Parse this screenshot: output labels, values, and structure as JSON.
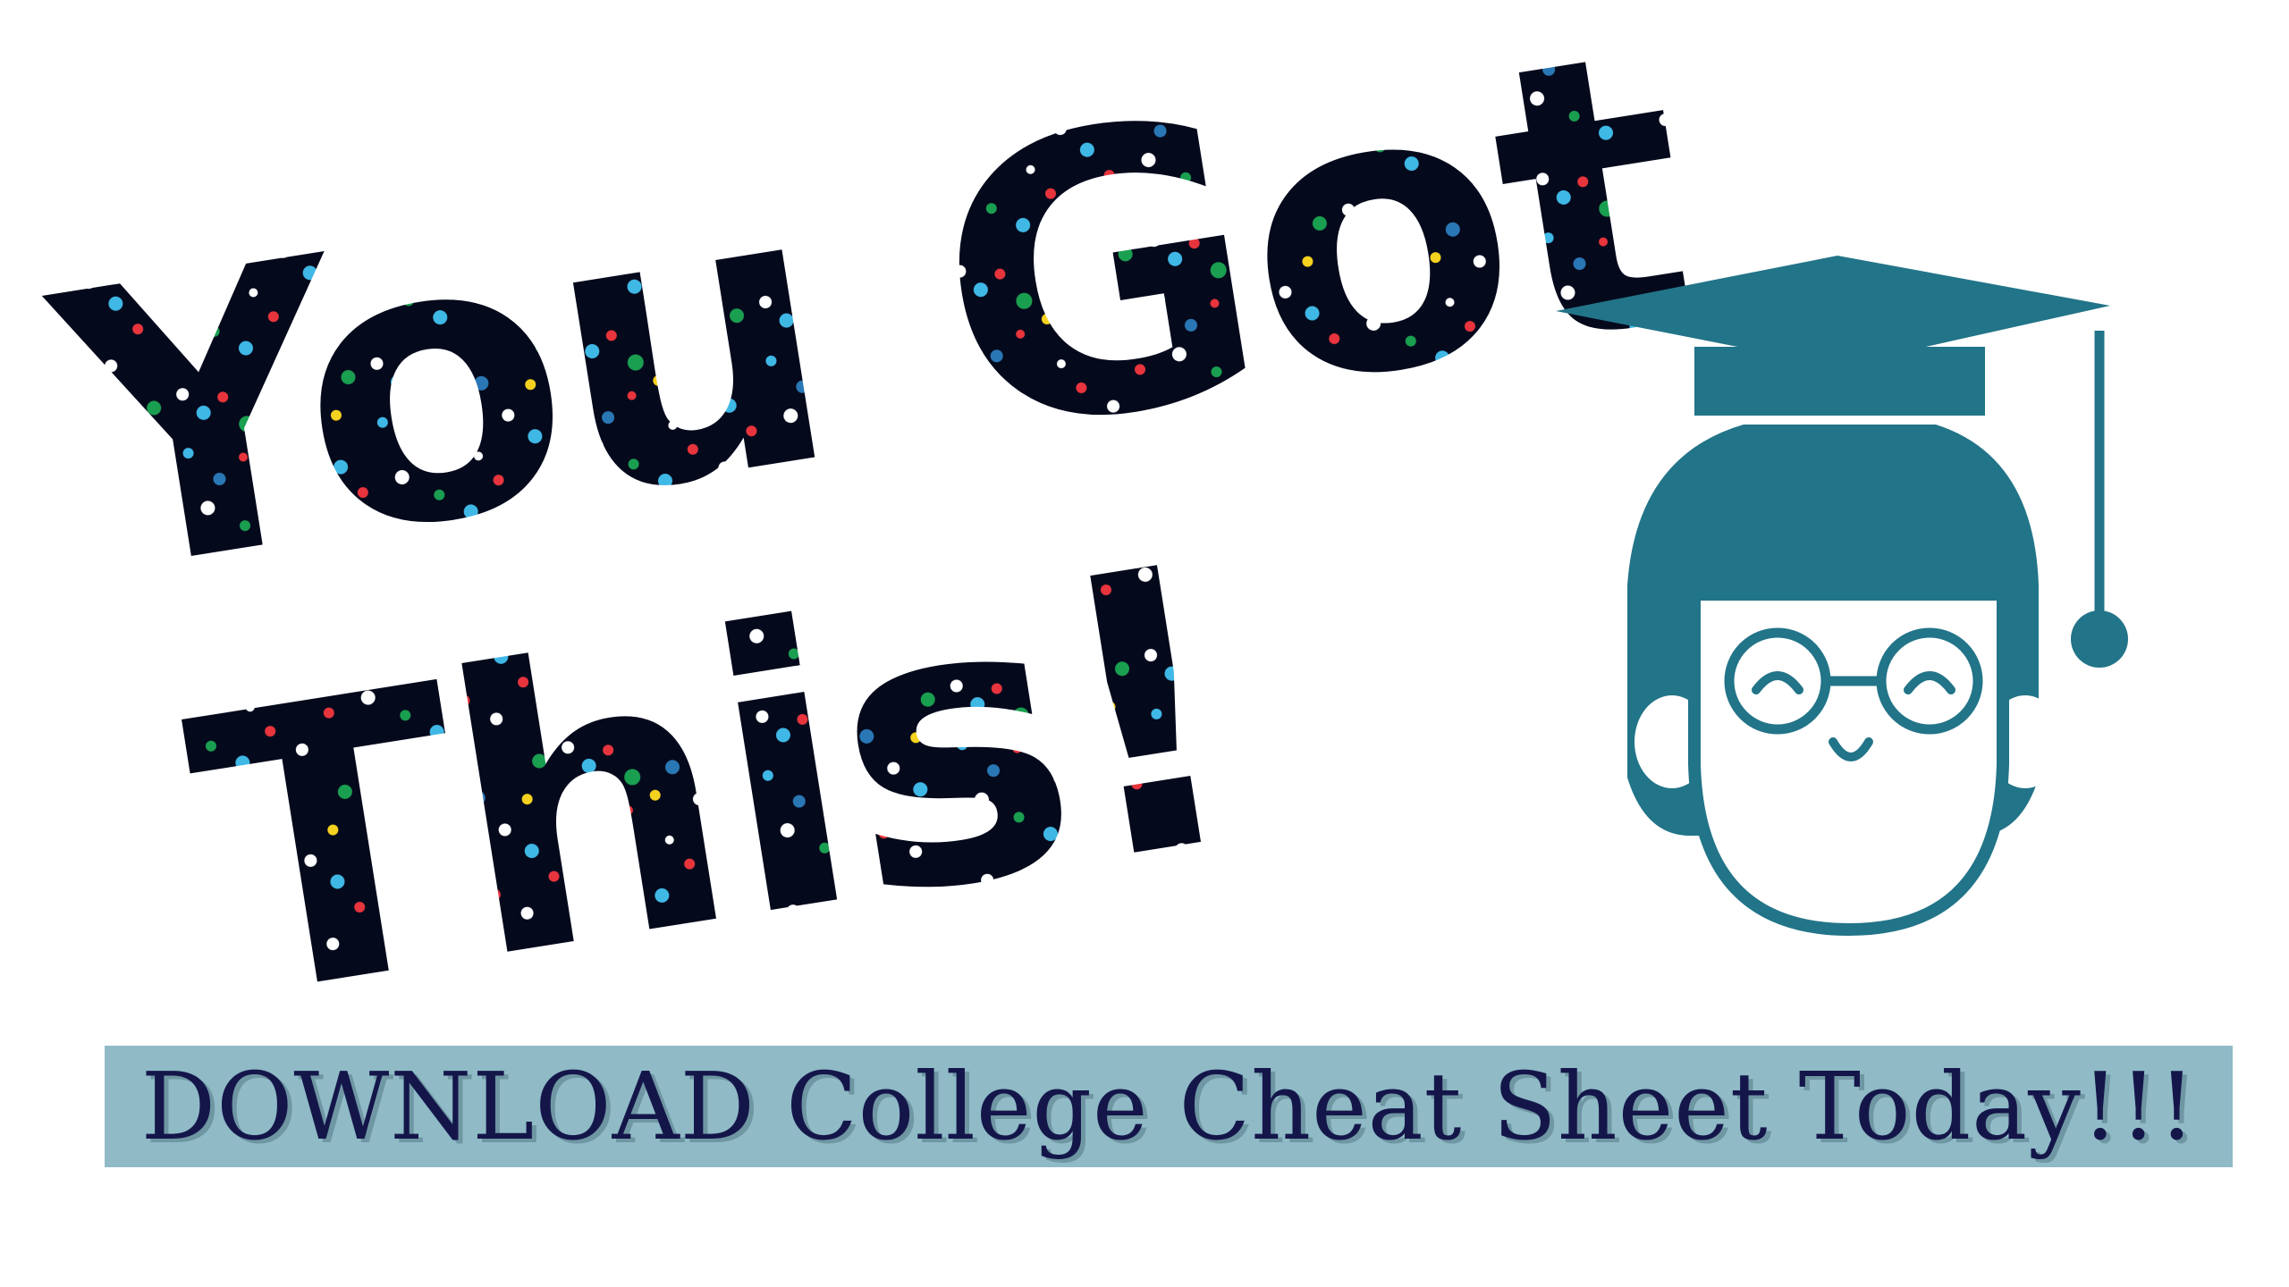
{
  "headline": {
    "line1": "You Got",
    "line2": "This!",
    "fill_color": "#05091c",
    "confetti_colors": [
      "#ffffff",
      "#3fb8e6",
      "#1a9e50",
      "#e8343c",
      "#f5d21f",
      "#2a77b5"
    ]
  },
  "mascot": {
    "icon": "graduate-student-icon",
    "color": "#227488"
  },
  "cta": {
    "label": "DOWNLOAD College Cheat Sheet Today!!!",
    "background": "#8fbac6",
    "text_color": "#14164a"
  }
}
